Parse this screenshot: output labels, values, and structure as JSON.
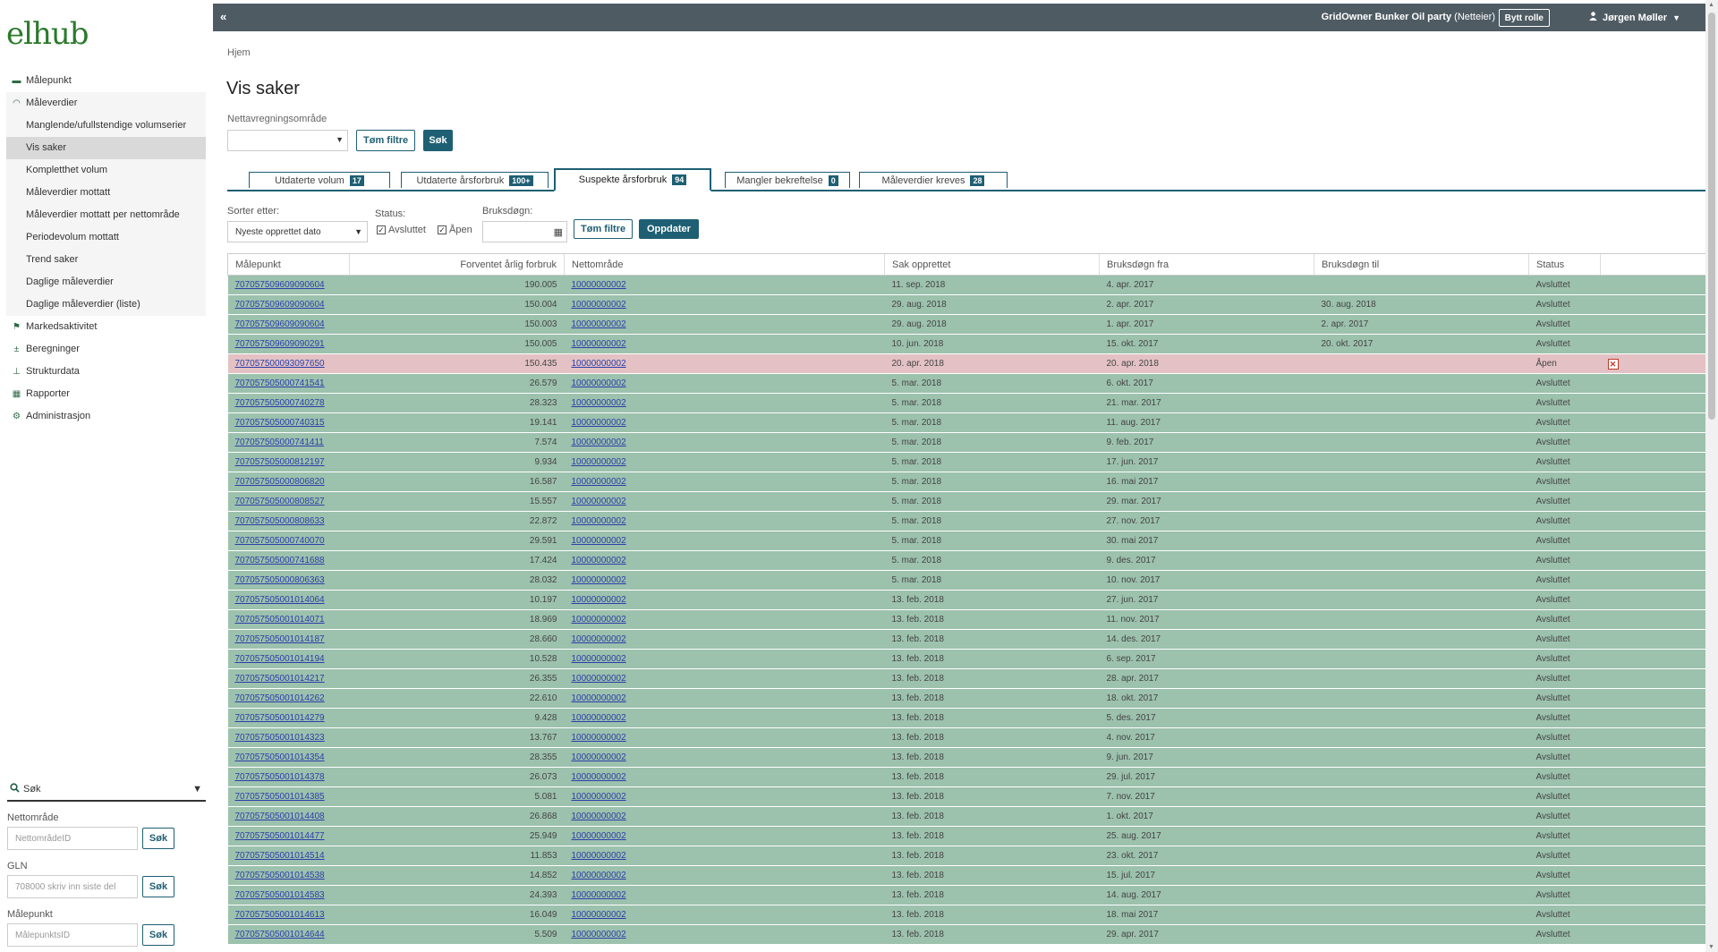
{
  "logo": "elhub",
  "sidebar": {
    "items": [
      {
        "label": "Målepunkt",
        "icon": "▬",
        "sub": false
      },
      {
        "label": "Måleverdier",
        "icon": "◠",
        "sub": false,
        "group": true
      },
      {
        "label": "Manglende/ufullstendige volumserier",
        "sub": true,
        "group": true
      },
      {
        "label": "Vis saker",
        "sub": true,
        "group": true,
        "active": true
      },
      {
        "label": "Kompletthet volum",
        "sub": true,
        "group": true
      },
      {
        "label": "Måleverdier mottatt",
        "sub": true,
        "group": true
      },
      {
        "label": "Måleverdier mottatt per nettområde",
        "sub": true,
        "group": true
      },
      {
        "label": "Periodevolum mottatt",
        "sub": true,
        "group": true
      },
      {
        "label": "Trend saker",
        "sub": true,
        "group": true
      },
      {
        "label": "Daglige måleverdier",
        "sub": true,
        "group": true
      },
      {
        "label": "Daglige måleverdier (liste)",
        "sub": true,
        "group": true
      },
      {
        "label": "Markedsaktivitet",
        "icon": "⚑",
        "sub": false
      },
      {
        "label": "Beregninger",
        "icon": "±",
        "sub": false
      },
      {
        "label": "Strukturdata",
        "icon": "⊥",
        "sub": false
      },
      {
        "label": "Rapporter",
        "icon": "▦",
        "sub": false
      },
      {
        "label": "Administrasjon",
        "icon": "⚙",
        "sub": false
      }
    ],
    "search": {
      "title": "Søk",
      "fields": [
        {
          "label": "Nettområde",
          "placeholder": "NettområdeID",
          "button": "Søk"
        },
        {
          "label": "GLN",
          "placeholder": "708000 skriv inn siste del",
          "button": "Søk"
        },
        {
          "label": "Målepunkt",
          "placeholder": "MålepunktsID",
          "button": "Søk"
        }
      ]
    }
  },
  "header": {
    "collapse": "«",
    "role_name": "GridOwner Bunker Oil party",
    "role_type": "(Netteier)",
    "switch_role": "Bytt rolle",
    "user": "Jørgen Møller"
  },
  "breadcrumb": "Hjem",
  "page_title": "Vis saker",
  "filter": {
    "area_label": "Nettavregningsområde",
    "clear": "Tøm filtre",
    "search": "Søk"
  },
  "tabs": [
    {
      "label": "Utdaterte volum",
      "count": "17"
    },
    {
      "label": "Utdaterte årsforbruk",
      "count": "100+"
    },
    {
      "label": "Suspekte årsforbruk",
      "count": "94",
      "active": true
    },
    {
      "label": "Mangler bekreftelse",
      "count": "0"
    },
    {
      "label": "Måleverdier kreves",
      "count": "28"
    }
  ],
  "list_filter": {
    "sort_label": "Sorter etter:",
    "sort_value": "Nyeste opprettet dato",
    "status_label": "Status:",
    "status_closed": "Avsluttet",
    "status_open": "Åpen",
    "date_label": "Bruksdøgn:",
    "clear": "Tøm filtre",
    "update": "Oppdater"
  },
  "table": {
    "columns": [
      "Målepunkt",
      "Forventet årlig forbruk",
      "Nettområde",
      "Sak opprettet",
      "Bruksdøgn fra",
      "Bruksdøgn til",
      "Status"
    ],
    "rows": [
      {
        "mp": "707057509609090604",
        "fb": "190.005",
        "no": "10000000002",
        "op": "11. sep. 2018",
        "fra": "4. apr. 2017",
        "til": "",
        "st": "Avsluttet"
      },
      {
        "mp": "707057509609090604",
        "fb": "150.004",
        "no": "10000000002",
        "op": "29. aug. 2018",
        "fra": "2. apr. 2017",
        "til": "30. aug. 2018",
        "st": "Avsluttet"
      },
      {
        "mp": "707057509609090604",
        "fb": "150.003",
        "no": "10000000002",
        "op": "29. aug. 2018",
        "fra": "1. apr. 2017",
        "til": "2. apr. 2017",
        "st": "Avsluttet"
      },
      {
        "mp": "707057509609090291",
        "fb": "150.005",
        "no": "10000000002",
        "op": "10. jun. 2018",
        "fra": "15. okt. 2017",
        "til": "20. okt. 2017",
        "st": "Avsluttet"
      },
      {
        "mp": "707057500093097650",
        "fb": "150.435",
        "no": "10000000002",
        "op": "20. apr. 2018",
        "fra": "20. apr. 2018",
        "til": "",
        "st": "Åpen",
        "open": true
      },
      {
        "mp": "707057505000741541",
        "fb": "26.579",
        "no": "10000000002",
        "op": "5. mar. 2018",
        "fra": "6. okt. 2017",
        "til": "",
        "st": "Avsluttet"
      },
      {
        "mp": "707057505000740278",
        "fb": "28.323",
        "no": "10000000002",
        "op": "5. mar. 2018",
        "fra": "21. mar. 2017",
        "til": "",
        "st": "Avsluttet"
      },
      {
        "mp": "707057505000740315",
        "fb": "19.141",
        "no": "10000000002",
        "op": "5. mar. 2018",
        "fra": "11. aug. 2017",
        "til": "",
        "st": "Avsluttet"
      },
      {
        "mp": "707057505000741411",
        "fb": "7.574",
        "no": "10000000002",
        "op": "5. mar. 2018",
        "fra": "9. feb. 2017",
        "til": "",
        "st": "Avsluttet"
      },
      {
        "mp": "707057505000812197",
        "fb": "9.934",
        "no": "10000000002",
        "op": "5. mar. 2018",
        "fra": "17. jun. 2017",
        "til": "",
        "st": "Avsluttet"
      },
      {
        "mp": "707057505000806820",
        "fb": "16.587",
        "no": "10000000002",
        "op": "5. mar. 2018",
        "fra": "16. mai 2017",
        "til": "",
        "st": "Avsluttet"
      },
      {
        "mp": "707057505000808527",
        "fb": "15.557",
        "no": "10000000002",
        "op": "5. mar. 2018",
        "fra": "29. mar. 2017",
        "til": "",
        "st": "Avsluttet"
      },
      {
        "mp": "707057505000808633",
        "fb": "22.872",
        "no": "10000000002",
        "op": "5. mar. 2018",
        "fra": "27. nov. 2017",
        "til": "",
        "st": "Avsluttet"
      },
      {
        "mp": "707057505000740070",
        "fb": "29.591",
        "no": "10000000002",
        "op": "5. mar. 2018",
        "fra": "30. mai 2017",
        "til": "",
        "st": "Avsluttet"
      },
      {
        "mp": "707057505000741688",
        "fb": "17.424",
        "no": "10000000002",
        "op": "5. mar. 2018",
        "fra": "9. des. 2017",
        "til": "",
        "st": "Avsluttet"
      },
      {
        "mp": "707057505000806363",
        "fb": "28.032",
        "no": "10000000002",
        "op": "5. mar. 2018",
        "fra": "10. nov. 2017",
        "til": "",
        "st": "Avsluttet"
      },
      {
        "mp": "707057505001014064",
        "fb": "10.197",
        "no": "10000000002",
        "op": "13. feb. 2018",
        "fra": "27. jun. 2017",
        "til": "",
        "st": "Avsluttet"
      },
      {
        "mp": "707057505001014071",
        "fb": "18.969",
        "no": "10000000002",
        "op": "13. feb. 2018",
        "fra": "11. nov. 2017",
        "til": "",
        "st": "Avsluttet"
      },
      {
        "mp": "707057505001014187",
        "fb": "28.660",
        "no": "10000000002",
        "op": "13. feb. 2018",
        "fra": "14. des. 2017",
        "til": "",
        "st": "Avsluttet"
      },
      {
        "mp": "707057505001014194",
        "fb": "10.528",
        "no": "10000000002",
        "op": "13. feb. 2018",
        "fra": "6. sep. 2017",
        "til": "",
        "st": "Avsluttet"
      },
      {
        "mp": "707057505001014217",
        "fb": "26.355",
        "no": "10000000002",
        "op": "13. feb. 2018",
        "fra": "28. apr. 2017",
        "til": "",
        "st": "Avsluttet"
      },
      {
        "mp": "707057505001014262",
        "fb": "22.610",
        "no": "10000000002",
        "op": "13. feb. 2018",
        "fra": "18. okt. 2017",
        "til": "",
        "st": "Avsluttet"
      },
      {
        "mp": "707057505001014279",
        "fb": "9.428",
        "no": "10000000002",
        "op": "13. feb. 2018",
        "fra": "5. des. 2017",
        "til": "",
        "st": "Avsluttet"
      },
      {
        "mp": "707057505001014323",
        "fb": "13.767",
        "no": "10000000002",
        "op": "13. feb. 2018",
        "fra": "4. nov. 2017",
        "til": "",
        "st": "Avsluttet"
      },
      {
        "mp": "707057505001014354",
        "fb": "28.355",
        "no": "10000000002",
        "op": "13. feb. 2018",
        "fra": "9. jun. 2017",
        "til": "",
        "st": "Avsluttet"
      },
      {
        "mp": "707057505001014378",
        "fb": "26.073",
        "no": "10000000002",
        "op": "13. feb. 2018",
        "fra": "29. jul. 2017",
        "til": "",
        "st": "Avsluttet"
      },
      {
        "mp": "707057505001014385",
        "fb": "5.081",
        "no": "10000000002",
        "op": "13. feb. 2018",
        "fra": "7. nov. 2017",
        "til": "",
        "st": "Avsluttet"
      },
      {
        "mp": "707057505001014408",
        "fb": "26.868",
        "no": "10000000002",
        "op": "13. feb. 2018",
        "fra": "1. okt. 2017",
        "til": "",
        "st": "Avsluttet"
      },
      {
        "mp": "707057505001014477",
        "fb": "25.949",
        "no": "10000000002",
        "op": "13. feb. 2018",
        "fra": "25. aug. 2017",
        "til": "",
        "st": "Avsluttet"
      },
      {
        "mp": "707057505001014514",
        "fb": "11.853",
        "no": "10000000002",
        "op": "13. feb. 2018",
        "fra": "23. okt. 2017",
        "til": "",
        "st": "Avsluttet"
      },
      {
        "mp": "707057505001014538",
        "fb": "14.852",
        "no": "10000000002",
        "op": "13. feb. 2018",
        "fra": "15. jul. 2017",
        "til": "",
        "st": "Avsluttet"
      },
      {
        "mp": "707057505001014583",
        "fb": "24.393",
        "no": "10000000002",
        "op": "13. feb. 2018",
        "fra": "14. aug. 2017",
        "til": "",
        "st": "Avsluttet"
      },
      {
        "mp": "707057505001014613",
        "fb": "16.049",
        "no": "10000000002",
        "op": "13. feb. 2018",
        "fra": "18. mai 2017",
        "til": "",
        "st": "Avsluttet"
      },
      {
        "mp": "707057505001014644",
        "fb": "5.509",
        "no": "10000000002",
        "op": "13. feb. 2018",
        "fra": "29. apr. 2017",
        "til": "",
        "st": "Avsluttet"
      }
    ]
  },
  "colors": {
    "closed_row": "#9cc1ad",
    "open_row": "#e3c1c4",
    "accent": "#1e5f73",
    "header_bar": "#4e5b63"
  }
}
